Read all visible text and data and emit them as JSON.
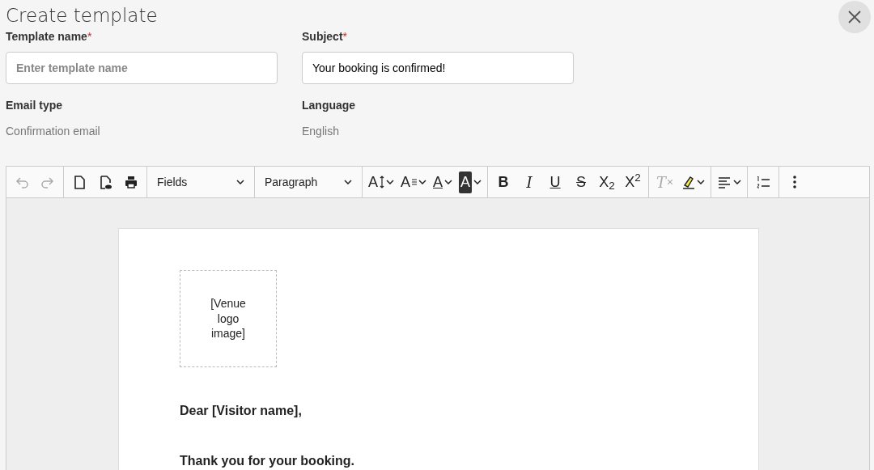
{
  "title": "Create template",
  "fields": [
    {
      "label": "Template name",
      "required_mark": "*",
      "placeholder": "Enter template name"
    },
    {
      "label": "Subject",
      "required_mark": "*",
      "value": "Your booking is confirmed!"
    }
  ],
  "info": [
    {
      "label": "Email type",
      "value": "Confirmation email"
    },
    {
      "label": "Language",
      "value": "English"
    }
  ],
  "toolbar": [
    [
      {
        "kind": "undo",
        "disabled": true
      },
      {
        "kind": "redo",
        "disabled": true
      }
    ],
    [
      {
        "kind": "new-document",
        "disabled": false
      },
      {
        "kind": "preview",
        "disabled": false
      },
      {
        "kind": "print",
        "disabled": false
      }
    ],
    [
      {
        "kind": "select",
        "label": "Fields"
      }
    ],
    [
      {
        "kind": "select",
        "label": "Paragraph"
      }
    ],
    [
      {
        "kind": "font-size",
        "label": "A",
        "caret": true
      },
      {
        "kind": "font-format",
        "label": "A",
        "caret": true
      },
      {
        "kind": "font-color",
        "label": "A",
        "caret": true
      },
      {
        "kind": "background-color",
        "label": "A",
        "caret": true
      }
    ],
    [
      {
        "kind": "bold",
        "label": "B"
      },
      {
        "kind": "italic",
        "label": "I"
      },
      {
        "kind": "underline",
        "label": "U"
      },
      {
        "kind": "strike",
        "label": "S"
      },
      {
        "kind": "script",
        "label": "X$_{2}$"
      },
      {
        "kind": "script",
        "label": "X$^{2}$"
      }
    ],
    [
      {
        "kind": "clear-format",
        "label": "T",
        "disabled": true
      },
      {
        "kind": "highlight",
        "caret": true,
        "disabled": false
      }
    ],
    [
      {
        "kind": "align",
        "caret": true,
        "disabled": false
      }
    ],
    [
      {
        "kind": "numbered-list",
        "disabled": false
      }
    ],
    [
      {
        "kind": "more",
        "disabled": false
      }
    ]
  ],
  "document": {
    "logo_placeholder": "[Venue logo image]",
    "paragraphs": [
      "Dear [Visitor name],",
      "Thank you for your booking."
    ]
  }
}
